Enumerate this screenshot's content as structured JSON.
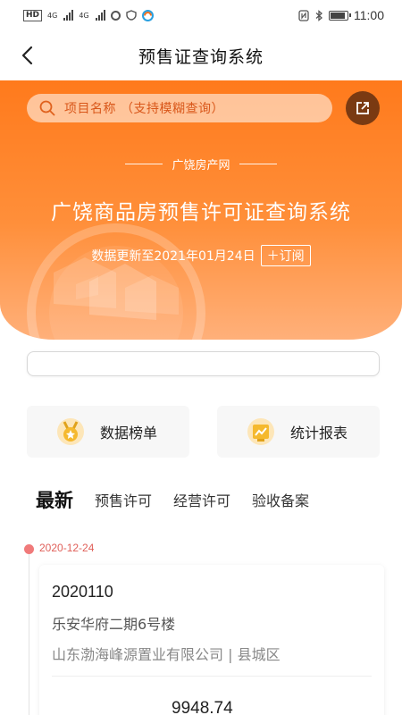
{
  "status_bar": {
    "badge": "HD",
    "signal_1_label": "4G",
    "signal_2_label": "4G",
    "time": "11:00",
    "icons": [
      "hd-icon",
      "signal-icon",
      "signal-icon",
      "circle-icon",
      "vpn-shield-icon",
      "app-icon",
      "nfc-icon",
      "bluetooth-icon",
      "battery-icon"
    ]
  },
  "header": {
    "title": "预售证查询系统",
    "back_icon": "chevron-left-icon"
  },
  "banner": {
    "search_placeholder": "项目名称 （支持模糊查询）",
    "site_name": "广饶房产网",
    "title": "广饶商品房预售许可证查询系统",
    "update_text": "数据更新至2021年01月24日",
    "subscribe_label": "＋订阅",
    "accent": "#ff7a1c"
  },
  "quick_links": [
    {
      "label": "数据榜单",
      "icon": "medal-icon"
    },
    {
      "label": "统计报表",
      "icon": "chart-report-icon"
    }
  ],
  "tabs": [
    {
      "label": "最新",
      "active": true
    },
    {
      "label": "预售许可",
      "active": false
    },
    {
      "label": "经营许可",
      "active": false
    },
    {
      "label": "验收备案",
      "active": false
    }
  ],
  "timeline": {
    "date": "2020-12-24",
    "record": {
      "id": "2020110",
      "name": "乐安华府二期6号楼",
      "company": "山东渤海峰源置业有限公司 | 县城区",
      "area": "9948.74"
    }
  }
}
